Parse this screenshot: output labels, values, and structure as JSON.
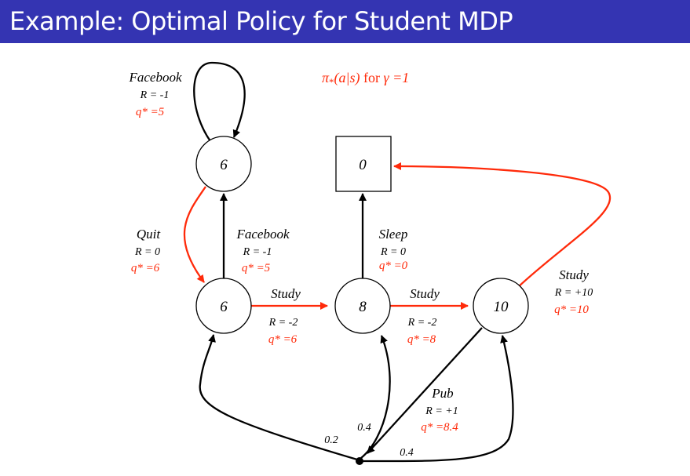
{
  "header": {
    "title": "Example: Optimal Policy for Student MDP"
  },
  "policy_caption": {
    "pi": "π",
    "star": "*",
    "args": "(a|s)",
    "for": " for ",
    "gamma": "γ =1"
  },
  "colors": {
    "header_bg": "#3434b2",
    "optimal": "#ff2a0a",
    "edge": "#000000"
  },
  "states": [
    {
      "id": "facebook",
      "value": "6"
    },
    {
      "id": "sleep-terminal",
      "value": "0"
    },
    {
      "id": "class1",
      "value": "6"
    },
    {
      "id": "class2",
      "value": "8"
    },
    {
      "id": "class3",
      "value": "10"
    }
  ],
  "actions": {
    "facebook_loop": {
      "name": "Facebook",
      "reward": "R = -1",
      "q": "q* =5"
    },
    "quit": {
      "name": "Quit",
      "reward": "R = 0",
      "q": "q* =6"
    },
    "facebook": {
      "name": "Facebook",
      "reward": "R = -1",
      "q": "q* =5"
    },
    "study1": {
      "name": "Study",
      "reward": "R = -2",
      "q": "q* =6"
    },
    "sleep": {
      "name": "Sleep",
      "reward": "R = 0",
      "q": "q* =0"
    },
    "study2": {
      "name": "Study",
      "reward": "R = -2",
      "q": "q* =8"
    },
    "study3": {
      "name": "Study",
      "reward": "R = +10",
      "q": "q* =10"
    },
    "pub": {
      "name": "Pub",
      "reward": "R = +1",
      "q": "q* =8.4"
    }
  },
  "pub_transitions": [
    {
      "to": "class1",
      "prob": "0.2"
    },
    {
      "to": "class2",
      "prob": "0.4"
    },
    {
      "to": "class3",
      "prob": "0.4"
    }
  ]
}
